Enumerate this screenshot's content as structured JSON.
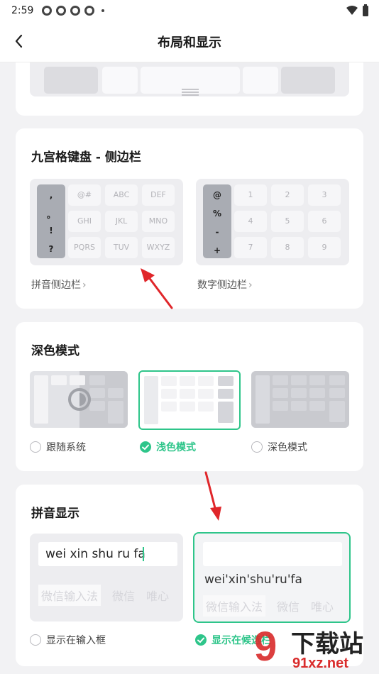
{
  "status": {
    "time": "2:59"
  },
  "header": {
    "title": "布局和显示",
    "back_icon": "back-arrow-icon"
  },
  "nine_grid": {
    "title": "九宫格键盘 - 侧边栏",
    "pinyin": {
      "side_keys": [
        ",",
        "。",
        "!",
        "?"
      ],
      "keys": [
        "@#",
        "ABC",
        "DEF",
        "GHI",
        "JKL",
        "MNO",
        "PQRS",
        "TUV",
        "WXYZ"
      ],
      "link": "拼音侧边栏"
    },
    "number": {
      "side_keys": [
        "@",
        "%",
        "-",
        "+"
      ],
      "keys": [
        "1",
        "2",
        "3",
        "4",
        "5",
        "6",
        "7",
        "8",
        "9"
      ],
      "link": "数字侧边栏"
    }
  },
  "dark_mode": {
    "title": "深色模式",
    "options": [
      {
        "label": "跟随系统",
        "selected": false
      },
      {
        "label": "浅色模式",
        "selected": true
      },
      {
        "label": "深色模式",
        "selected": false
      }
    ]
  },
  "pinyin_display": {
    "title": "拼音显示",
    "input_box_option": {
      "field_text": "wei xin shu ru fa",
      "label": "显示在输入框",
      "selected": false
    },
    "candidate_option": {
      "pinyin_text": "wei'xin'shu'ru'fa",
      "label": "显示在候选栏",
      "selected": true
    },
    "candidates": [
      "微信输入法",
      "微信",
      "唯心"
    ]
  },
  "watermark": {
    "glyph": "9",
    "text": "下载站",
    "url_text": "91xz.net"
  },
  "colors": {
    "accent": "#2ec58a",
    "arrow": "#e0262a"
  }
}
